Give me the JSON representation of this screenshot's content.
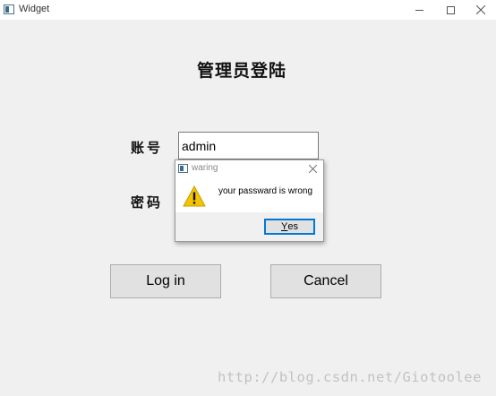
{
  "window": {
    "title": "Widget",
    "icon": "app-window-icon",
    "controls": [
      "minimize-icon",
      "maximize-icon",
      "close-icon"
    ]
  },
  "main": {
    "title": "管理员登陆",
    "account_label": "账号",
    "account_value": "admin",
    "password_label": "密码",
    "password_value": "",
    "login_label": "Log in",
    "cancel_label": "Cancel"
  },
  "dialog": {
    "title": "waring",
    "icon": "warning-icon",
    "message": "your passward is wrong",
    "yes_mnemonic": "Y",
    "yes_rest": "es"
  },
  "watermark": "http://blog.csdn.net/Giotoolee",
  "colors": {
    "background": "#f0f0f0",
    "button": "#e1e1e1",
    "focus": "#0078d7",
    "warning": "#f5c400"
  }
}
